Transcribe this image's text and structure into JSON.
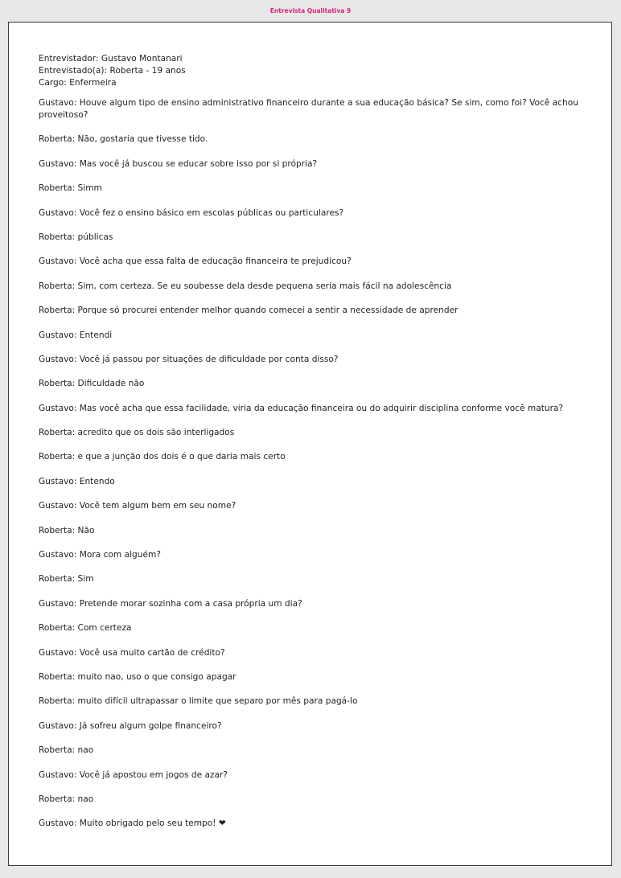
{
  "header": {
    "title": "Entrevista Qualitativa 9"
  },
  "meta": {
    "interviewer": "Entrevistador: Gustavo Montanari",
    "interviewee": "Entrevistado(a): Roberta - 19 anos",
    "role": "Cargo: Enfermeira"
  },
  "transcript": [
    "Gustavo: Houve algum tipo de ensino administrativo financeiro durante a sua educação básica? Se sim, como foi? Você achou proveitoso?",
    "Roberta: Não, gostaria que tivesse tido.",
    "Gustavo: Mas você já buscou se educar sobre isso por si própria?",
    "Roberta: Simm",
    "Gustavo: Você fez o ensino básico em escolas públicas ou particulares?",
    "Roberta: públicas",
    "Gustavo: Você acha que essa falta de educação financeira te prejudicou?",
    "Roberta: Sim, com certeza. Se eu soubesse dela desde pequena seria mais fácil na adolescência",
    "Roberta: Porque só procurei entender melhor quando comecei a sentir a necessidade de aprender",
    "Gustavo: Entendi",
    "Gustavo: Você já passou por situações de dificuldade por conta disso?",
    "Roberta: Dificuldade não",
    "Gustavo: Mas você acha que essa facilidade, viria da educação financeira ou do adquirir disciplina conforme você matura?",
    "Roberta: acredito que os dois são interligados",
    "Roberta: e que a junção dos dois é o que daria mais certo",
    "Gustavo: Entendo",
    "Gustavo: Você tem algum bem em seu nome?",
    "Roberta: Não",
    "Gustavo: Mora com alguém?",
    "Roberta: Sim",
    "Gustavo: Pretende morar sozinha com a casa própria um dia?",
    "Roberta: Com certeza",
    "Gustavo: Você usa muito cartão de crédito?",
    "Roberta: muito nao, uso o que consigo apagar",
    "Roberta: muito difícil ultrapassar o limite que separo por mês para pagá-lo",
    "Gustavo: Já sofreu algum golpe financeiro?",
    "Roberta: nao",
    "Gustavo: Você já apostou em jogos de azar?",
    "Roberta: nao",
    "Gustavo: Muito obrigado pelo seu tempo! ❤"
  ]
}
